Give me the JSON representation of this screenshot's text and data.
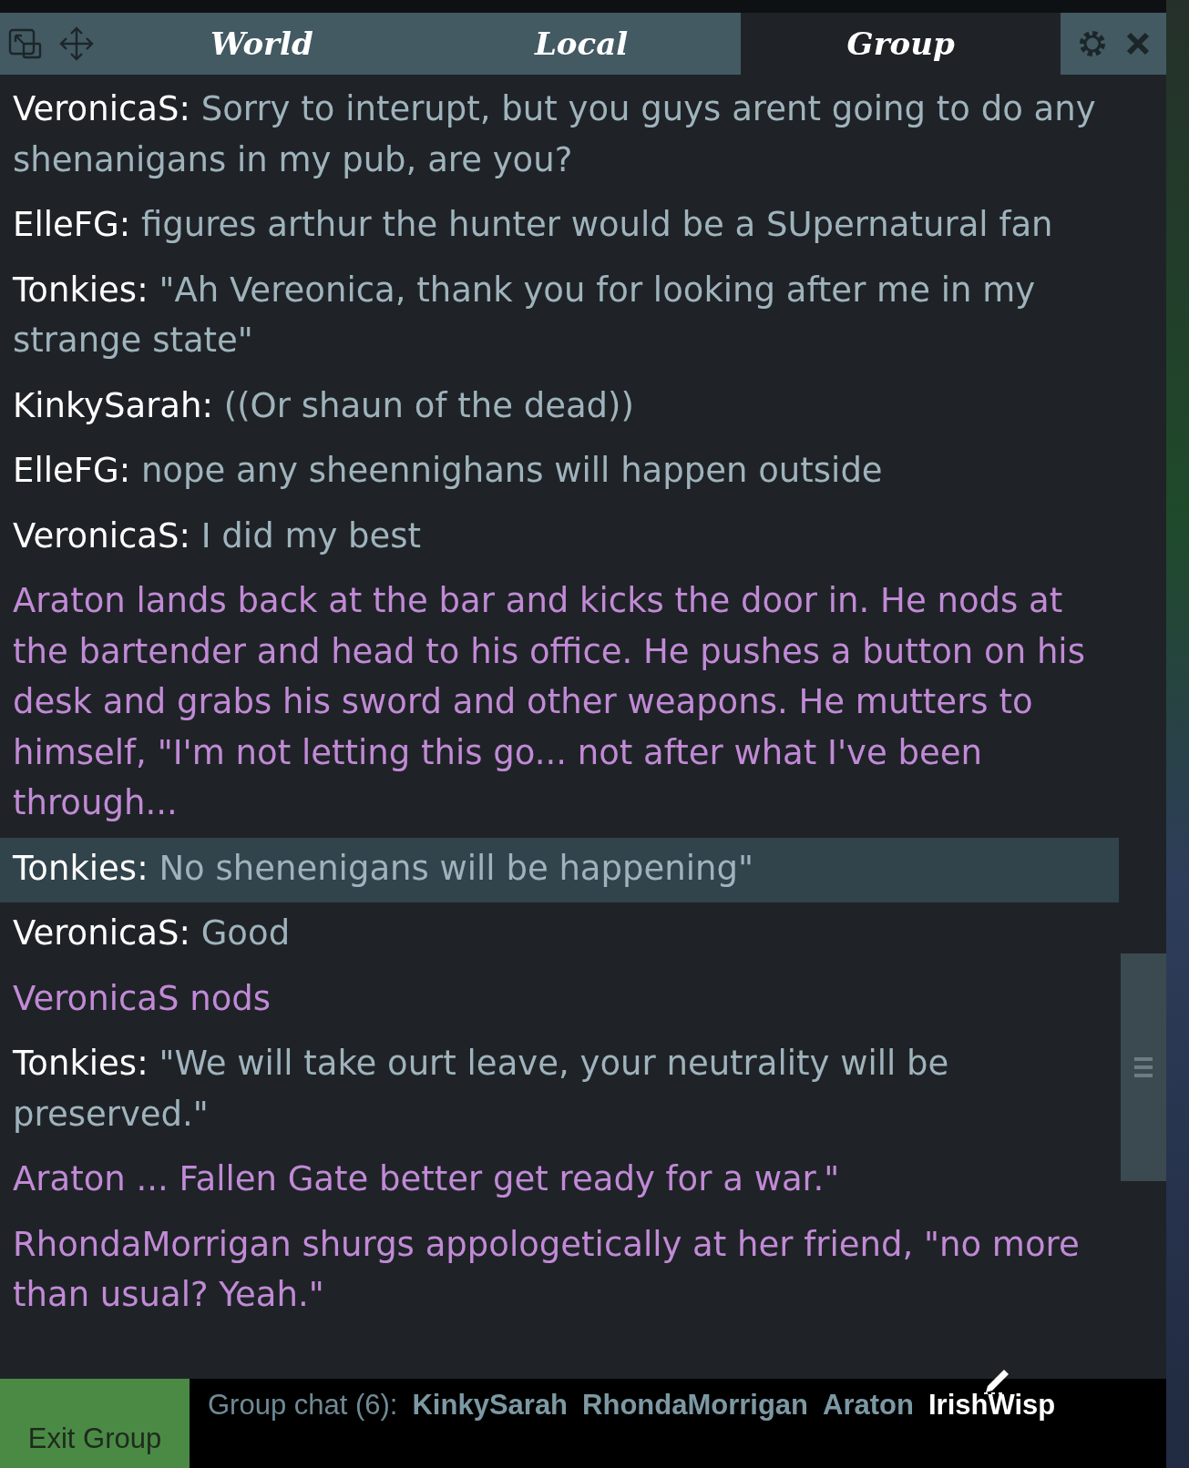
{
  "tabs": [
    {
      "label": "World",
      "selected": false
    },
    {
      "label": "Local",
      "selected": false
    },
    {
      "label": "Group",
      "selected": true
    }
  ],
  "messages": [
    {
      "kind": "say",
      "name": "VeronicaS:",
      "text": "Sorry to interupt, but you guys arent going to do any shenanigans in my pub, are you?",
      "highlighted": false
    },
    {
      "kind": "say",
      "name": "ElleFG:",
      "text": "figures arthur the hunter would be a SUpernatural fan",
      "highlighted": false
    },
    {
      "kind": "say",
      "name": "Tonkies:",
      "text": "\"Ah Vereonica, thank you for looking after me in my strange state\"",
      "highlighted": false
    },
    {
      "kind": "say",
      "name": "KinkySarah:",
      "text": "((Or shaun of the dead))",
      "highlighted": false
    },
    {
      "kind": "say",
      "name": "ElleFG:",
      "text": "nope any sheennighans will happen outside",
      "highlighted": false
    },
    {
      "kind": "say",
      "name": "VeronicaS:",
      "text": "I did my best",
      "highlighted": false
    },
    {
      "kind": "emote",
      "text": "Araton lands back at the bar and kicks the door in. He nods at the bartender and head to his office. He pushes a button on his desk and grabs his sword and other weapons. He mutters to himself, \"I'm not letting this go... not after what I've been through...",
      "highlighted": false
    },
    {
      "kind": "say",
      "name": "Tonkies:",
      "text": "No shenenigans will be happening\"",
      "highlighted": true
    },
    {
      "kind": "say",
      "name": "VeronicaS:",
      "text": "Good",
      "highlighted": false
    },
    {
      "kind": "emote",
      "text": "VeronicaS nods",
      "highlighted": false
    },
    {
      "kind": "say",
      "name": "Tonkies:",
      "text": "\"We will take ourt leave, your neutrality will be preserved.\"",
      "highlighted": false
    },
    {
      "kind": "emote",
      "text": "Araton ... Fallen Gate better get ready for a war.\"",
      "highlighted": false
    },
    {
      "kind": "emote",
      "text": "RhondaMorrigan shurgs appologetically at her friend, \"no more than usual?  Yeah.\"",
      "highlighted": false
    }
  ],
  "footer": {
    "exit_button": "Exit Group",
    "members_label": "Group chat (6):",
    "members": [
      {
        "name": "KinkySarah",
        "typing": false
      },
      {
        "name": "RhondaMorrigan",
        "typing": false
      },
      {
        "name": "Araton",
        "typing": false
      },
      {
        "name": "IrishWisp",
        "typing": true
      }
    ]
  }
}
